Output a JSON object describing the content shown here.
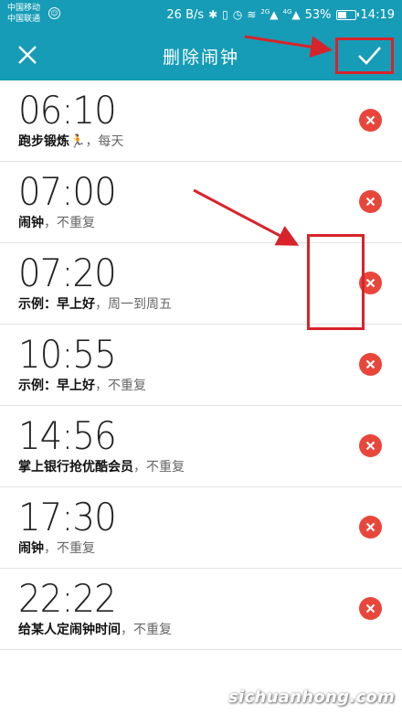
{
  "status_bar": {
    "carrier_1": "中国移动",
    "carrier_2": "中国联通",
    "net_speed": "26 B/s",
    "signal_1": "2G",
    "signal_2": "4G",
    "battery_percent": "53%",
    "battery_level": 0.53,
    "time": "14:19"
  },
  "header": {
    "title": "删除闹钟",
    "bg_color": "#169cb6"
  },
  "alarms": [
    {
      "time": "06:10",
      "name": "跑步锻炼🏃",
      "repeat": "，每天"
    },
    {
      "time": "07:00",
      "name": "闹钟",
      "repeat": "，不重复"
    },
    {
      "time": "07:20",
      "name": "示例：早上好",
      "repeat": "，周一到周五"
    },
    {
      "time": "10:55",
      "name": "示例：早上好",
      "repeat": "，不重复"
    },
    {
      "time": "14:56",
      "name": "掌上银行抢优酷会员",
      "repeat": "，不重复"
    },
    {
      "time": "17:30",
      "name": "闹钟",
      "repeat": "，不重复"
    },
    {
      "time": "22:22",
      "name": "给某人定闹钟时间",
      "repeat": "，不重复"
    }
  ],
  "accent": {
    "delete_color": "#e9463b",
    "annotation_color": "#d9232a"
  },
  "icons": {
    "close": "close-icon",
    "confirm": "check-icon",
    "delete": "delete-icon"
  },
  "watermark": "sichuanhong.com"
}
